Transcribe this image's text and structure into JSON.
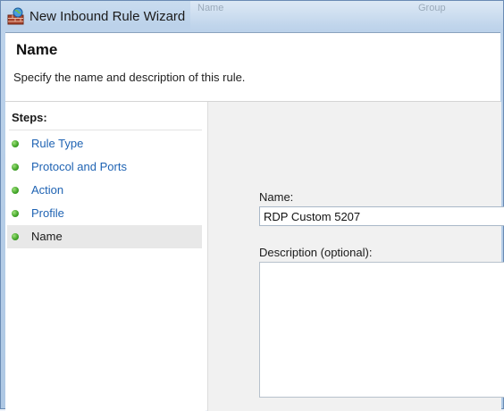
{
  "window": {
    "title": "New Inbound Rule Wizard",
    "background_column_1": "Name",
    "background_column_2": "Group"
  },
  "header": {
    "title": "Name",
    "subtitle": "Specify the name and description of this rule."
  },
  "steps": {
    "title": "Steps:",
    "items": [
      {
        "label": "Rule Type"
      },
      {
        "label": "Protocol and Ports"
      },
      {
        "label": "Action"
      },
      {
        "label": "Profile"
      },
      {
        "label": "Name"
      }
    ],
    "active_index": 4
  },
  "form": {
    "name_label": "Name:",
    "name_value": "RDP Custom 5207",
    "description_label": "Description (optional):",
    "description_value": ""
  },
  "colors": {
    "link": "#1f63b3",
    "step_dot": "#3fa326",
    "active_step_bg": "#e8e8e8"
  },
  "icons": {
    "title_icon": "firewall-icon",
    "step_icon": "green-dot-icon"
  }
}
